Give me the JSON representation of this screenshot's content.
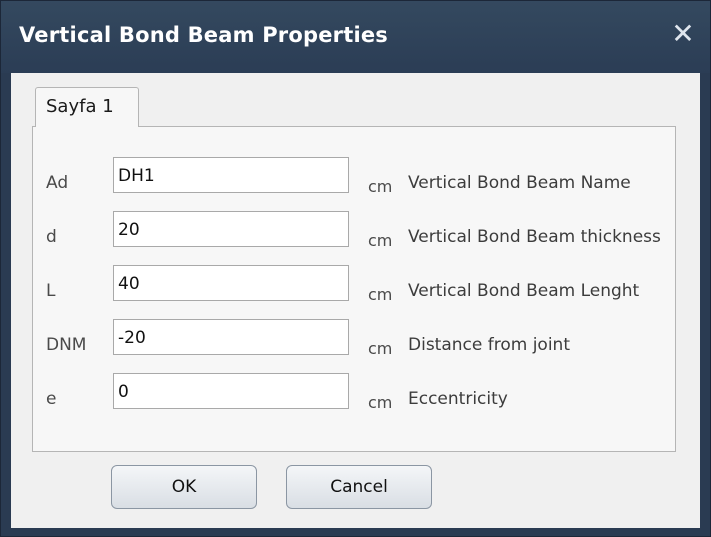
{
  "window": {
    "title": "Vertical Bond Beam Properties",
    "close_glyph": "✕"
  },
  "tabs": [
    {
      "label": "Sayfa 1",
      "selected": true
    }
  ],
  "fields": [
    {
      "label": "Ad",
      "value": "DH1",
      "unit": "cm",
      "description": "Vertical Bond Beam Name"
    },
    {
      "label": "d",
      "value": "20",
      "unit": "cm",
      "description": "Vertical Bond Beam thickness"
    },
    {
      "label": "L",
      "value": "40",
      "unit": "cm",
      "description": "Vertical Bond Beam Lenght"
    },
    {
      "label": "DNM",
      "value": "-20",
      "unit": "cm",
      "description": "Distance from joint"
    },
    {
      "label": "e",
      "value": "0",
      "unit": "cm",
      "description": "Eccentricity"
    }
  ],
  "buttons": {
    "ok_label": "OK",
    "cancel_label": "Cancel"
  },
  "colors": {
    "titlebar": "#2f435a",
    "client": "#f0f0f0",
    "panel": "#f7f7f7"
  }
}
